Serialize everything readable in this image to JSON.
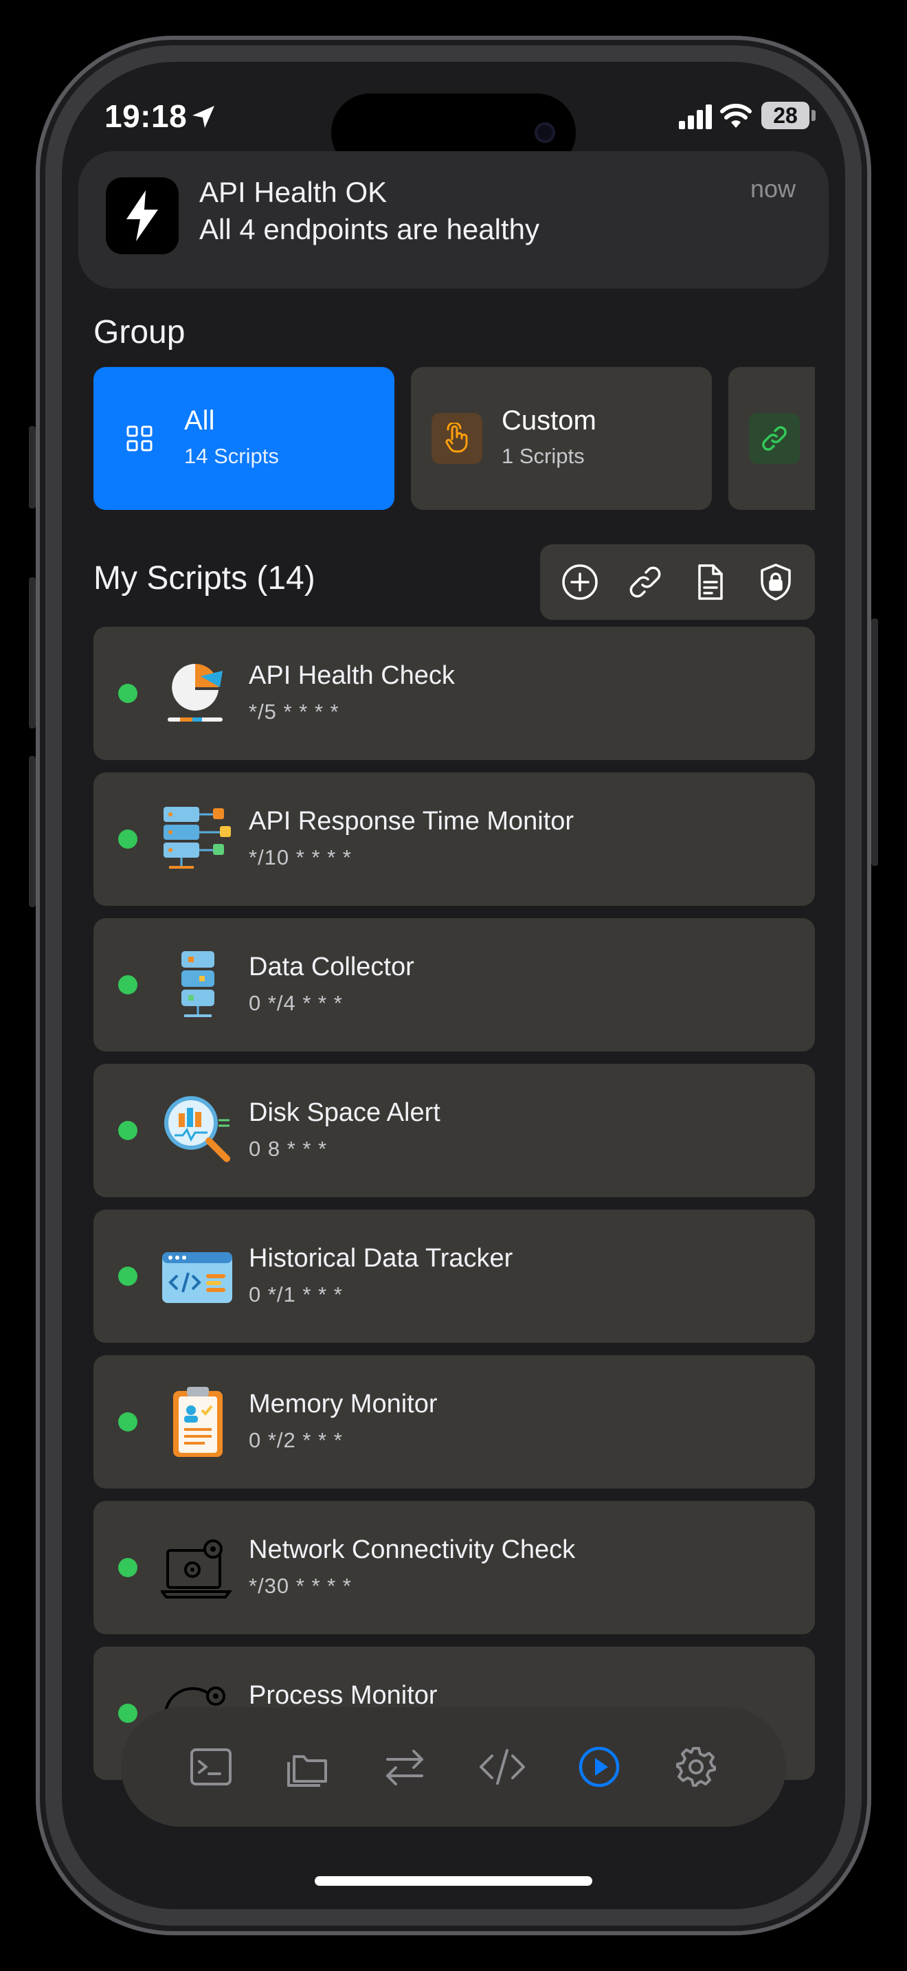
{
  "status_bar": {
    "time": "19:18",
    "battery": "28"
  },
  "notification": {
    "title": "API Health OK",
    "body": "All 4 endpoints are healthy",
    "time": "now",
    "icon": "bolt-icon"
  },
  "group": {
    "title": "Group",
    "items": [
      {
        "name": "All",
        "count": "14 Scripts",
        "icon": "grid-icon",
        "active": true
      },
      {
        "name": "Custom",
        "count": "1 Scripts",
        "icon": "hand-tap-icon",
        "active": false
      },
      {
        "name": "",
        "count": "",
        "icon": "link-icon",
        "active": false
      }
    ]
  },
  "scripts": {
    "title": "My Scripts (14)",
    "toolbar": [
      "add-circle-icon",
      "link-icon",
      "document-icon",
      "shield-lock-icon"
    ],
    "items": [
      {
        "name": "API Health Check",
        "cron": "*/5 * * * *",
        "status_color": "#34c759"
      },
      {
        "name": "API Response Time Monitor",
        "cron": "*/10 * * * *",
        "status_color": "#34c759"
      },
      {
        "name": "Data Collector",
        "cron": "0 */4 * * *",
        "status_color": "#34c759"
      },
      {
        "name": "Disk Space Alert",
        "cron": "0 8 * * *",
        "status_color": "#34c759"
      },
      {
        "name": "Historical Data Tracker",
        "cron": "0 */1 * * *",
        "status_color": "#34c759"
      },
      {
        "name": "Memory Monitor",
        "cron": "0 */2 * * *",
        "status_color": "#34c759"
      },
      {
        "name": "Network Connectivity Check",
        "cron": "*/30 * * * *",
        "status_color": "#34c759"
      },
      {
        "name": "Process Monitor",
        "cron": "",
        "status_color": "#34c759"
      }
    ]
  },
  "tab_bar": {
    "tabs": [
      "terminal-icon",
      "folders-icon",
      "transfer-icon",
      "code-icon",
      "play-circle-icon",
      "gear-icon"
    ],
    "active_index": 4
  },
  "colors": {
    "accent": "#0a7aff",
    "status_ok": "#34c759",
    "card": "#3a3936"
  }
}
